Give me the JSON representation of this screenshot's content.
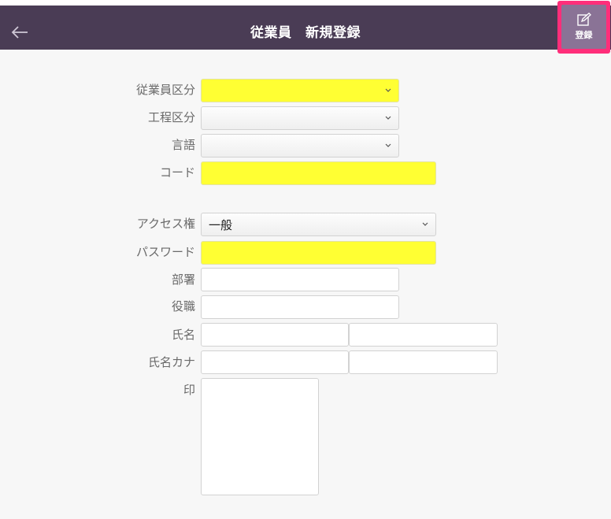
{
  "header": {
    "title": "従業員　新規登録",
    "save_label": "登録"
  },
  "form": {
    "employee_type_label": "従業員区分",
    "process_type_label": "工程区分",
    "language_label": "言語",
    "code_label": "コード",
    "access_label": "アクセス権",
    "access_value": "一般",
    "password_label": "パスワード",
    "department_label": "部署",
    "position_label": "役職",
    "name_label": "氏名",
    "name_kana_label": "氏名カナ",
    "stamp_label": "印"
  },
  "colors": {
    "header_bg": "#4a3c55",
    "required_field": "#ffff33",
    "save_highlight": "#ff2e7a"
  }
}
